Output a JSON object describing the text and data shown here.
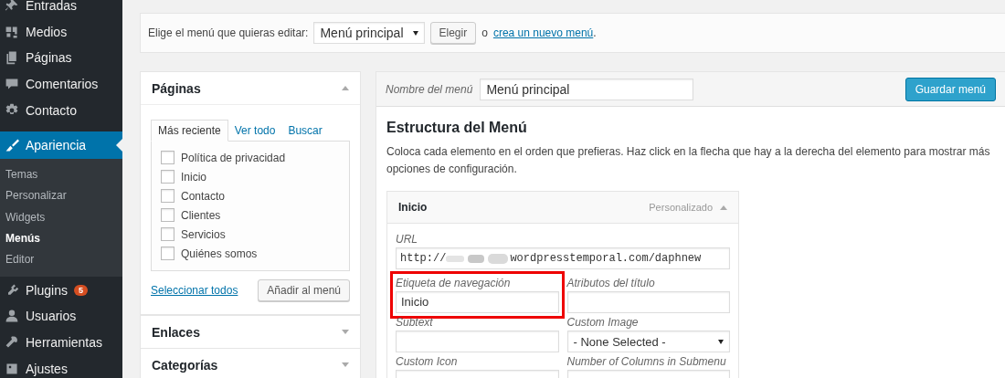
{
  "sidebar": {
    "items": [
      {
        "label": "Entradas",
        "selected": false
      },
      {
        "label": "Medios",
        "selected": false
      },
      {
        "label": "Páginas",
        "selected": false
      },
      {
        "label": "Comentarios",
        "selected": false
      },
      {
        "label": "Contacto",
        "selected": false,
        "separator_after": true
      },
      {
        "label": "Apariencia",
        "selected": true,
        "submenu": [
          {
            "label": "Temas",
            "selected": false
          },
          {
            "label": "Personalizar",
            "selected": false
          },
          {
            "label": "Widgets",
            "selected": false
          },
          {
            "label": "Menús",
            "selected": true
          },
          {
            "label": "Editor",
            "selected": false
          }
        ]
      },
      {
        "label": "Plugins",
        "selected": false,
        "badge": "5"
      },
      {
        "label": "Usuarios",
        "selected": false
      },
      {
        "label": "Herramientas",
        "selected": false
      },
      {
        "label": "Ajustes",
        "selected": false
      }
    ]
  },
  "menu_chooser": {
    "label": "Elige el menú que quieras editar:",
    "selected_menu": "Menú principal",
    "button": "Elegir",
    "or_text": "o",
    "link": "crea un nuevo menú",
    "after_link": "."
  },
  "left_panels": [
    {
      "title": "Páginas",
      "expanded": true,
      "tabs": [
        {
          "label": "Más reciente",
          "selected": true
        },
        {
          "label": "Ver todo",
          "selected": false
        },
        {
          "label": "Buscar",
          "selected": false
        }
      ],
      "items": [
        {
          "label": "Política de privacidad",
          "checked": false
        },
        {
          "label": "Inicio",
          "checked": false
        },
        {
          "label": "Contacto",
          "checked": false
        },
        {
          "label": "Clientes",
          "checked": false
        },
        {
          "label": "Servicios",
          "checked": false
        },
        {
          "label": "Quiénes somos",
          "checked": false
        }
      ],
      "select_all": "Seleccionar todos",
      "add_button": "Añadir al menú"
    },
    {
      "title": "Enlaces",
      "expanded": false
    },
    {
      "title": "Categorías",
      "expanded": false
    }
  ],
  "menu_editor": {
    "name_label": "Nombre del menú",
    "name_value": "Menú principal",
    "save_button": "Guardar menú",
    "heading": "Estructura del Menú",
    "description": "Coloca cada elemento en el orden que prefieras. Haz click en la flecha que hay a la derecha del elemento para mostrar más opciones de configuración.",
    "item": {
      "title": "Inicio",
      "type": "Personalizado",
      "expanded": true,
      "url": {
        "label": "URL",
        "start": "http://",
        "end": "wordpresstemporal.com/daphnew"
      },
      "fields": [
        {
          "kind": "text",
          "label": "Etiqueta de navegación",
          "value": "Inicio",
          "highlighted": true
        },
        {
          "kind": "text",
          "label": "Atributos del título",
          "highlighted": false
        },
        {
          "kind": "text",
          "label": "Subtext",
          "highlighted": false
        },
        {
          "kind": "select",
          "label": "Custom Image",
          "value": "- None Selected -",
          "highlighted": false
        },
        {
          "kind": "text",
          "label": "Custom Icon",
          "highlighted": false
        },
        {
          "kind": "text",
          "label": "Number of Columns in Submenu",
          "highlighted": false
        }
      ]
    }
  }
}
